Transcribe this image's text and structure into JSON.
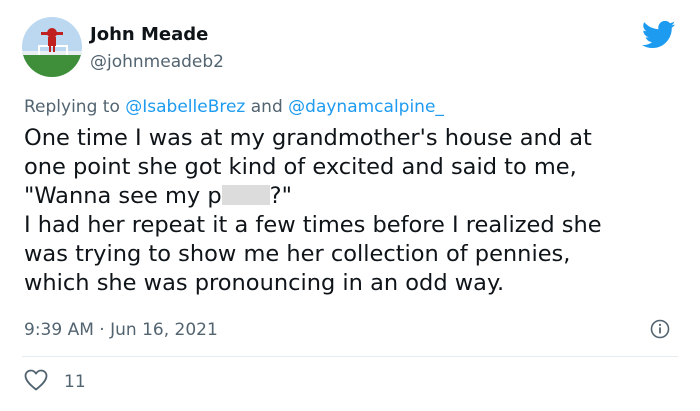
{
  "user": {
    "display_name": "John Meade",
    "handle": "@johnmeadeb2"
  },
  "reply_to": {
    "prefix": "Replying to",
    "handle_1": "@IsabelleBrez",
    "joiner": "and",
    "handle_2": "@daynamcalpine_"
  },
  "tweet": {
    "line_1": "One time I was at my grandmother's house and at",
    "line_2": "one point she got kind of excited and said to me,",
    "line_3_start": "\"Wanna see my p",
    "line_3_end": "?\"",
    "line_4": "I had her repeat it a few times before I realized she",
    "line_5": "was trying to show me her collection of pennies,",
    "line_6": "which she was pronouncing in an odd way."
  },
  "meta": {
    "time": "9:39 AM",
    "separator": "·",
    "date": "Jun 16, 2021"
  },
  "actions": {
    "like_count": "11"
  },
  "colors": {
    "accent": "#1d9bf0",
    "text": "#0f1419",
    "secondary": "#536471"
  },
  "icons": {
    "brand": "twitter-bird-icon",
    "info": "info-icon",
    "like": "heart-icon"
  }
}
